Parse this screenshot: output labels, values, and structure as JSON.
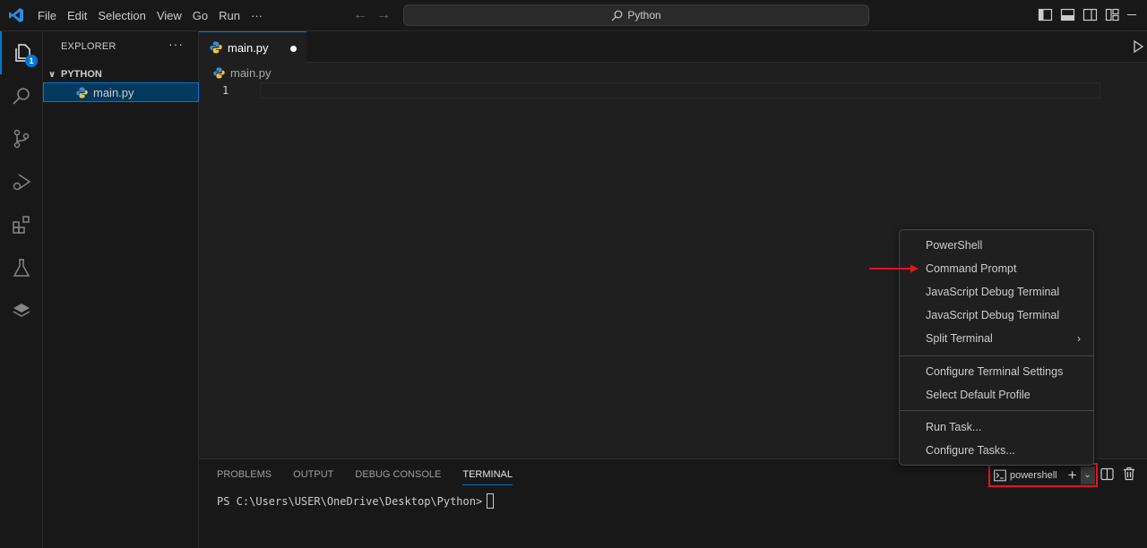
{
  "titlebar": {
    "menu": [
      "File",
      "Edit",
      "Selection",
      "View",
      "Go",
      "Run",
      "···"
    ],
    "search_text": "Python"
  },
  "activitybar": {
    "explorer_badge": "1"
  },
  "sidebar": {
    "title": "EXPLORER",
    "more": "···",
    "folder": "PYTHON",
    "file": "main.py"
  },
  "editor": {
    "tab_label": "main.py",
    "breadcrumb": "main.py",
    "line_number": "1"
  },
  "panel": {
    "tabs": [
      "PROBLEMS",
      "OUTPUT",
      "DEBUG CONSOLE",
      "TERMINAL"
    ],
    "active_tab": "TERMINAL",
    "prompt": "PS C:\\Users\\USER\\OneDrive\\Desktop\\Python>",
    "terminal_name": "powershell",
    "plus": "+",
    "chevron": "⌄"
  },
  "dropdown": {
    "group1": [
      "PowerShell",
      "Command Prompt",
      "JavaScript Debug Terminal",
      "JavaScript Debug Terminal",
      "Split Terminal"
    ],
    "submenu_arrow": "›",
    "group2": [
      "Configure Terminal Settings",
      "Select Default Profile"
    ],
    "group3": [
      "Run Task...",
      "Configure Tasks..."
    ]
  },
  "colors": {
    "accent": "#0078d4",
    "highlight": "#e81123"
  }
}
